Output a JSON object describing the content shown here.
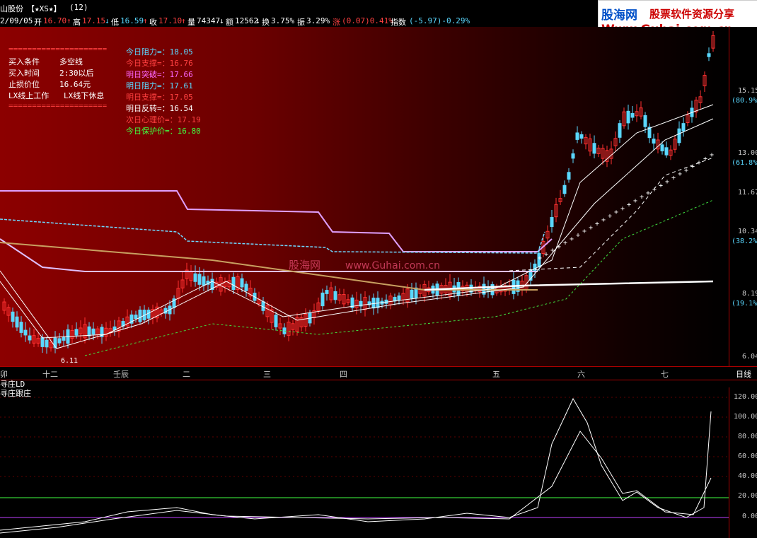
{
  "header": {
    "stock_name": "山股份",
    "tag": "【★XS★】",
    "count": "(12)"
  },
  "quote": {
    "date": "2/09/05",
    "open_label": "开",
    "open": "16.70",
    "high_label": "高",
    "high": "17.15",
    "low_label": "低",
    "low": "16.59",
    "close_label": "收",
    "close": "17.10",
    "vol_label": "量",
    "vol": "74347",
    "amt_label": "额",
    "amt": "12562",
    "turn_label": "换",
    "turn": "3.75%",
    "amp_label": "振",
    "amp": "3.29%",
    "chg_label": "涨",
    "chg": "(0.07)0.41%",
    "idx_label": "指数",
    "idx": "(-5.97)-0.29%"
  },
  "banner": {
    "brand": "股海网",
    "slogan": "股票软件资源分享",
    "url": "Www.Guhai.com.cn"
  },
  "conditions": {
    "rule_top": "=====================",
    "rows": [
      {
        "k": "买入条件",
        "v": "多空线"
      },
      {
        "k": "买入时间",
        "v": "2:30以后"
      },
      {
        "k": "止损价位",
        "v": "16.64元"
      },
      {
        "k": "LX线上工作",
        "v": "LX线下休息"
      }
    ],
    "rule_bottom": "====================="
  },
  "levels": [
    {
      "label": "今日阻力=：",
      "value": "18.05",
      "color": "#5ad8ff"
    },
    {
      "label": "今日支撑=：",
      "value": "16.76",
      "color": "#ff4040"
    },
    {
      "label": "明日突破=：",
      "value": "17.66",
      "color": "#ff66ff"
    },
    {
      "label": "明日阻力=：",
      "value": "17.61",
      "color": "#5ad8ff"
    },
    {
      "label": "明日支撑=：",
      "value": "17.05",
      "color": "#ff4040"
    },
    {
      "label": "明日反转=：",
      "value": "16.54",
      "color": "#ffffff"
    },
    {
      "label": "次日心理价=：",
      "value": "17.19",
      "color": "#ff4040"
    },
    {
      "label": "今日保护价=：",
      "value": "16.80",
      "color": "#40ff40"
    }
  ],
  "price_axis": {
    "ticks": [
      "15.15",
      "13.00",
      "11.67",
      "10.34",
      "8.19",
      "6.04"
    ],
    "pcts": [
      "(80.9%)",
      "(61.8%)",
      "(38.2%)",
      "(19.1%)"
    ]
  },
  "low_marker": "6.11",
  "watermark": {
    "cn": "股海网",
    "url": "www.Guhai.com.cn"
  },
  "date_axis": {
    "labels": [
      "卯",
      "十二",
      "壬辰",
      "二",
      "三",
      "四",
      "五",
      "六",
      "七"
    ],
    "period": "日线"
  },
  "indicator": {
    "header": "寻庄LD",
    "name": "寻庄跟庄",
    "ticks": [
      "120.00",
      "100.00",
      "80.00",
      "60.00",
      "40.00",
      "20.00",
      "0.00"
    ]
  },
  "colors": {
    "up": "#ff3030",
    "down": "#5ad8ff",
    "axis_red": "#aa0000",
    "level_green": "#40ff40",
    "level_purple": "#c040ff"
  }
}
